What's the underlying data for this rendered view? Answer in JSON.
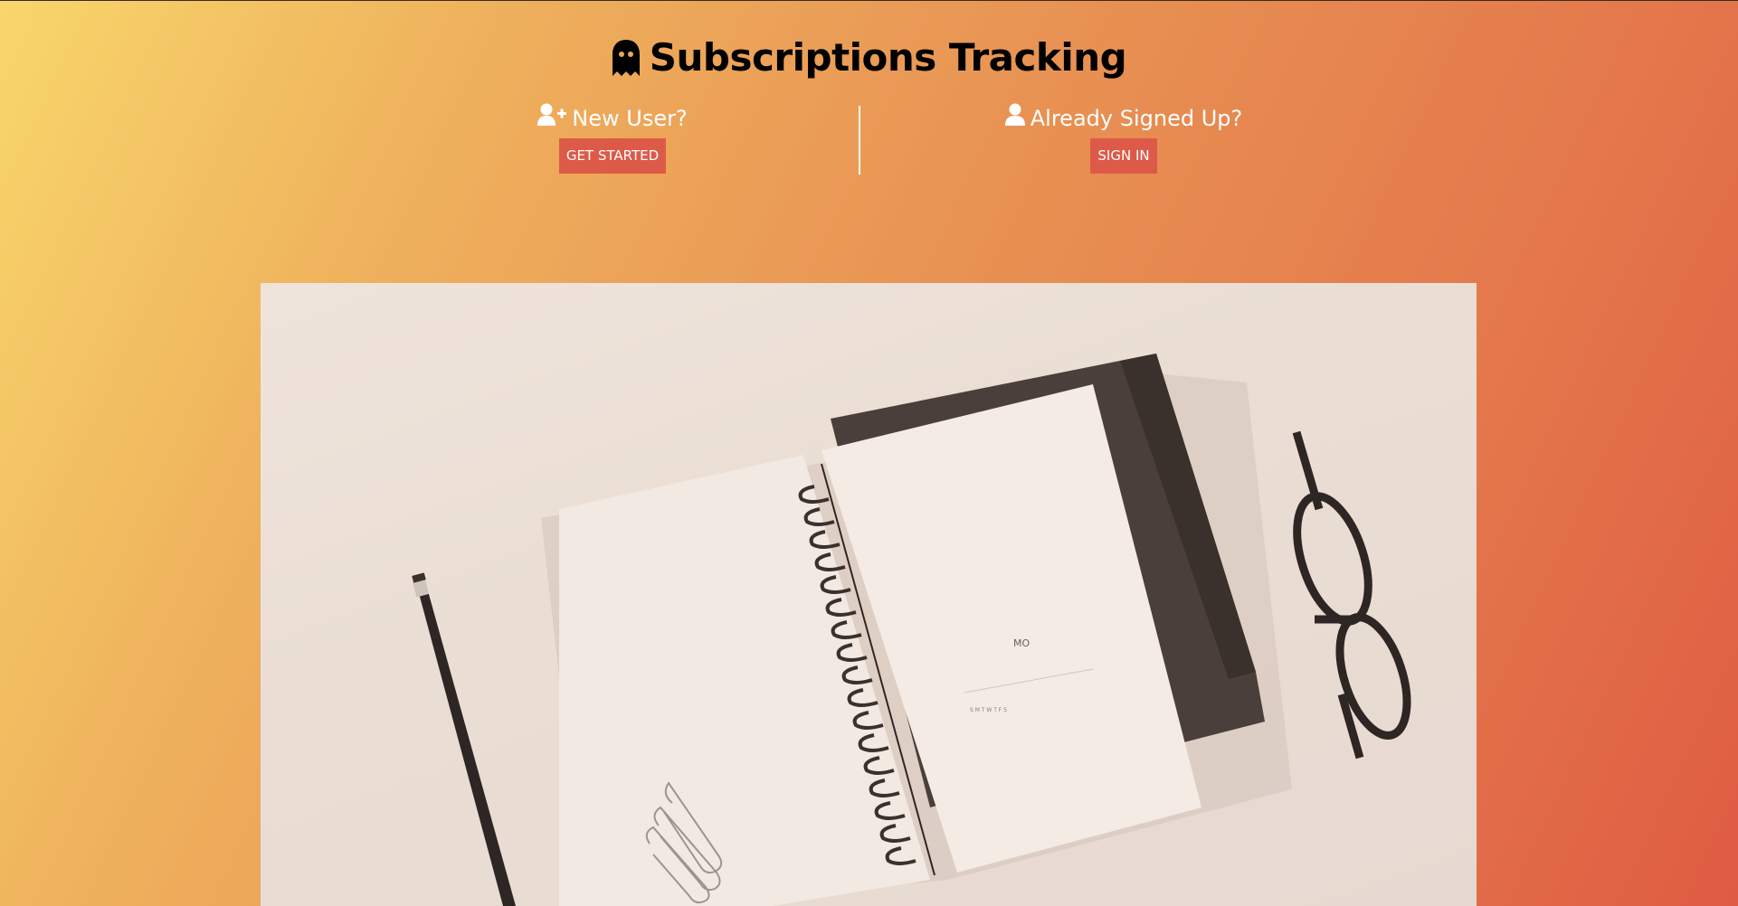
{
  "header": {
    "title": "Subscriptions Tracking",
    "icon": "ghost-icon"
  },
  "new_user": {
    "heading": "New User?",
    "icon": "user-plus-icon",
    "button_label": "GET STARTED"
  },
  "existing_user": {
    "heading": "Already Signed Up?",
    "icon": "user-icon",
    "button_label": "SIGN IN"
  },
  "hero_image": {
    "calendar_text": "MO",
    "weekdays": "S M T W T F S"
  },
  "colors": {
    "gradient_start": "#f8d66b",
    "gradient_end": "#df5c43",
    "button": "#dd5a48",
    "text_light": "#ffffff",
    "title_text": "#000000"
  }
}
